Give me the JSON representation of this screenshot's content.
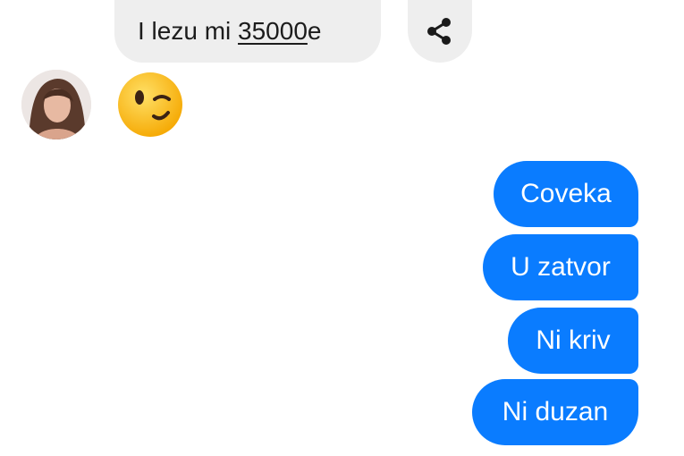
{
  "incoming": {
    "message_prefix": "I lezu mi ",
    "message_number": "35000",
    "message_suffix": "e",
    "share_icon": "share-icon",
    "avatar_icon": "contact-avatar",
    "emoji_icon": "winking-face-emoji"
  },
  "outgoing": {
    "messages": [
      "Coveka",
      "U zatvor",
      "Ni kriv",
      "Ni duzan"
    ]
  },
  "colors": {
    "incoming_bubble": "#eeeeee",
    "outgoing_bubble": "#0a7cff",
    "incoming_text": "#1c1c1c",
    "outgoing_text": "#ffffff"
  }
}
